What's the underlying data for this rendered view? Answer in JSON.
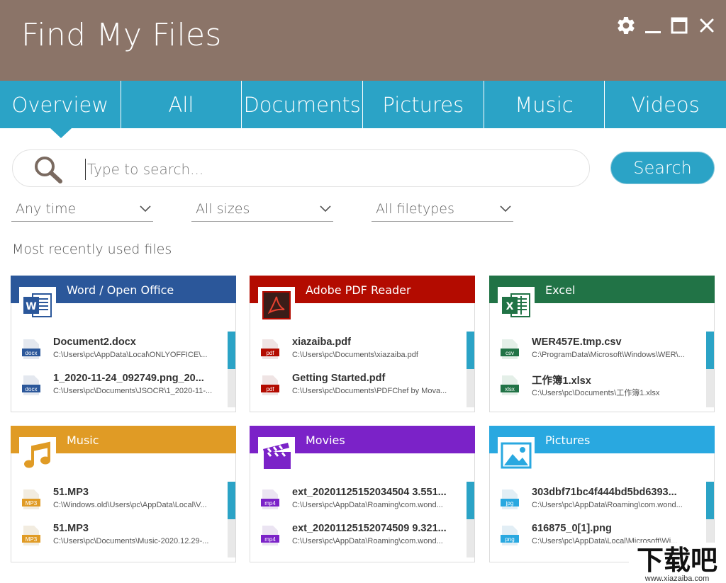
{
  "app": {
    "title": "Find My Files"
  },
  "tabs": [
    {
      "label": "Overview"
    },
    {
      "label": "All"
    },
    {
      "label": "Documents"
    },
    {
      "label": "Pictures"
    },
    {
      "label": "Music"
    },
    {
      "label": "Videos"
    }
  ],
  "search": {
    "placeholder": "Type to search...",
    "button_label": "Search"
  },
  "filters": {
    "time": "Any time",
    "size": "All sizes",
    "type": "All filetypes"
  },
  "section": {
    "title": "Most recently used files"
  },
  "colors": {
    "titlebar": "#8b7468",
    "accent": "#2ba3c6",
    "word": "#2b579a",
    "pdf": "#b30b00",
    "excel": "#217346",
    "music": "#e09b25",
    "movies": "#7b22c8",
    "pictures": "#29a8e0"
  },
  "cards": [
    {
      "title": "Word / Open Office",
      "icon": "word-icon",
      "files": [
        {
          "name": "Document2.docx",
          "path": "C:\\Users\\pc\\AppData\\Local\\ONLYOFFICE\\...",
          "ext": "docx"
        },
        {
          "name": "1_2020-11-24_092749.png_20...",
          "path": "C:\\Users\\pc\\Documents\\JSOCR\\1_2020-11-...",
          "ext": "docx"
        }
      ]
    },
    {
      "title": "Adobe PDF Reader",
      "icon": "pdf-reader-icon",
      "files": [
        {
          "name": "xiazaiba.pdf",
          "path": "C:\\Users\\pc\\Documents\\xiazaiba.pdf",
          "ext": "pdf"
        },
        {
          "name": "Getting Started.pdf",
          "path": "C:\\Users\\pc\\Documents\\PDFChef by Mova...",
          "ext": "pdf"
        }
      ]
    },
    {
      "title": "Excel",
      "icon": "excel-icon",
      "files": [
        {
          "name": "WER457E.tmp.csv",
          "path": "C:\\ProgramData\\Microsoft\\Windows\\WER\\...",
          "ext": "csv"
        },
        {
          "name": "工作簿1.xlsx",
          "path": "C:\\Users\\pc\\Documents\\工作簿1.xlsx",
          "ext": "xlsx"
        }
      ]
    },
    {
      "title": "Music",
      "icon": "music-note-icon",
      "files": [
        {
          "name": "51.MP3",
          "path": "C:\\Windows.old\\Users\\pc\\AppData\\Local\\V...",
          "ext": "MP3"
        },
        {
          "name": "51.MP3",
          "path": "C:\\Users\\pc\\Documents\\Music-2020.12.29-...",
          "ext": "MP3"
        }
      ]
    },
    {
      "title": "Movies",
      "icon": "clapperboard-icon",
      "files": [
        {
          "name": "ext_20201125152034504 3.551...",
          "path": "C:\\Users\\pc\\AppData\\Roaming\\com.wond...",
          "ext": "mp4"
        },
        {
          "name": "ext_20201125152074509 9.321...",
          "path": "C:\\Users\\pc\\AppData\\Roaming\\com.wond...",
          "ext": "mp4"
        }
      ]
    },
    {
      "title": "Pictures",
      "icon": "picture-icon",
      "files": [
        {
          "name": "303dbf71bc4f444bd5bd6393...",
          "path": "C:\\Users\\pc\\AppData\\Roaming\\com.wond...",
          "ext": "jpg"
        },
        {
          "name": "616875_0[1].png",
          "path": "C:\\Users\\pc\\AppData\\Local\\Microsoft\\Wi...",
          "ext": "png"
        }
      ]
    }
  ],
  "watermark": {
    "text": "下载吧",
    "url": "www.xiazaiba.com"
  }
}
